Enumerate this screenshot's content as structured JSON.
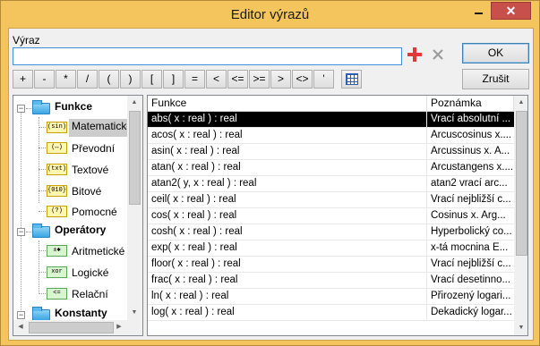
{
  "window": {
    "title": "Editor výrazů",
    "close_glyph": "✕"
  },
  "expression": {
    "label": "Výraz",
    "value": ""
  },
  "buttons": {
    "ok": "OK",
    "cancel": "Zrušit"
  },
  "operators": [
    "+",
    "-",
    "*",
    "/",
    "(",
    ")",
    "[",
    "]",
    "=",
    "<",
    "<=",
    ">=",
    ">",
    "<>",
    "'"
  ],
  "tree": {
    "categories": [
      {
        "label": "Funkce",
        "subs": [
          {
            "label": "Matematické",
            "icon": "(sin)",
            "selected": true
          },
          {
            "label": "Převodní",
            "icon": "(↔)"
          },
          {
            "label": "Textové",
            "icon": "(txt)"
          },
          {
            "label": "Bitové",
            "icon": "{010}"
          },
          {
            "label": "Pomocné",
            "icon": "(?)"
          }
        ]
      },
      {
        "label": "Operátory",
        "subs": [
          {
            "label": "Aritmetické",
            "icon": "±✱"
          },
          {
            "label": "Logické",
            "icon": "xor"
          },
          {
            "label": "Relační",
            "icon": "<="
          }
        ]
      },
      {
        "label": "Konstanty",
        "subs": []
      }
    ]
  },
  "table": {
    "headers": [
      "Funkce",
      "Poznámka"
    ],
    "rows": [
      [
        "abs( x : real ) : real",
        "Vrací absolutní ..."
      ],
      [
        "acos( x : real ) : real",
        "Arcuscosinus x...."
      ],
      [
        "asin( x : real ) : real",
        "Arcussinus x. A..."
      ],
      [
        "atan( x : real ) : real",
        "Arcustangens x...."
      ],
      [
        "atan2( y, x : real ) : real",
        "atan2 vrací arc..."
      ],
      [
        "ceil( x : real ) : real",
        "Vrací nejbližší c..."
      ],
      [
        "cos( x : real ) : real",
        "Cosinus x. Arg..."
      ],
      [
        "cosh( x : real ) : real",
        "Hyperbolický co..."
      ],
      [
        "exp( x : real ) : real",
        "x-tá mocnina E..."
      ],
      [
        "floor( x : real ) : real",
        "Vrací nejbližší c..."
      ],
      [
        "frac( x : real ) : real",
        "Vrací desetinno..."
      ],
      [
        "ln( x : real ) : real",
        "Přirozený logari..."
      ],
      [
        "log( x : real ) : real",
        "Dekadický logar..."
      ]
    ]
  },
  "colors": {
    "accent_add": "#e0383b",
    "frame": "#f4c55c",
    "selection": "#000000"
  }
}
